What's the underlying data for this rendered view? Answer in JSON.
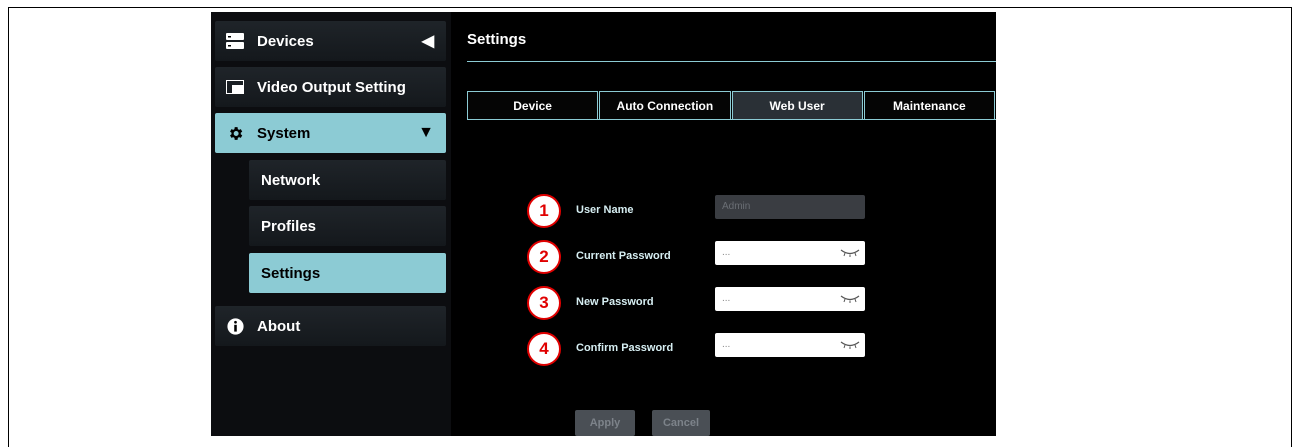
{
  "sidebar": {
    "devices_label": "Devices",
    "video_output_label": "Video Output Setting",
    "system_label": "System",
    "network_label": "Network",
    "profiles_label": "Profiles",
    "settings_label": "Settings",
    "about_label": "About"
  },
  "page": {
    "title": "Settings"
  },
  "tabs": [
    "Device",
    "Auto Connection",
    "Web User",
    "Maintenance"
  ],
  "form": {
    "user_name": {
      "num": "1",
      "label": "User Name",
      "value": "Admin"
    },
    "current_password": {
      "num": "2",
      "label": "Current Password",
      "value": "..."
    },
    "new_password": {
      "num": "3",
      "label": "New Password",
      "value": "..."
    },
    "confirm_password": {
      "num": "4",
      "label": "Confirm Password",
      "value": "..."
    }
  },
  "buttons": {
    "apply": "Apply",
    "cancel": "Cancel"
  },
  "colors": {
    "accent": "#8ccbd4",
    "annotation": "#e00000"
  }
}
